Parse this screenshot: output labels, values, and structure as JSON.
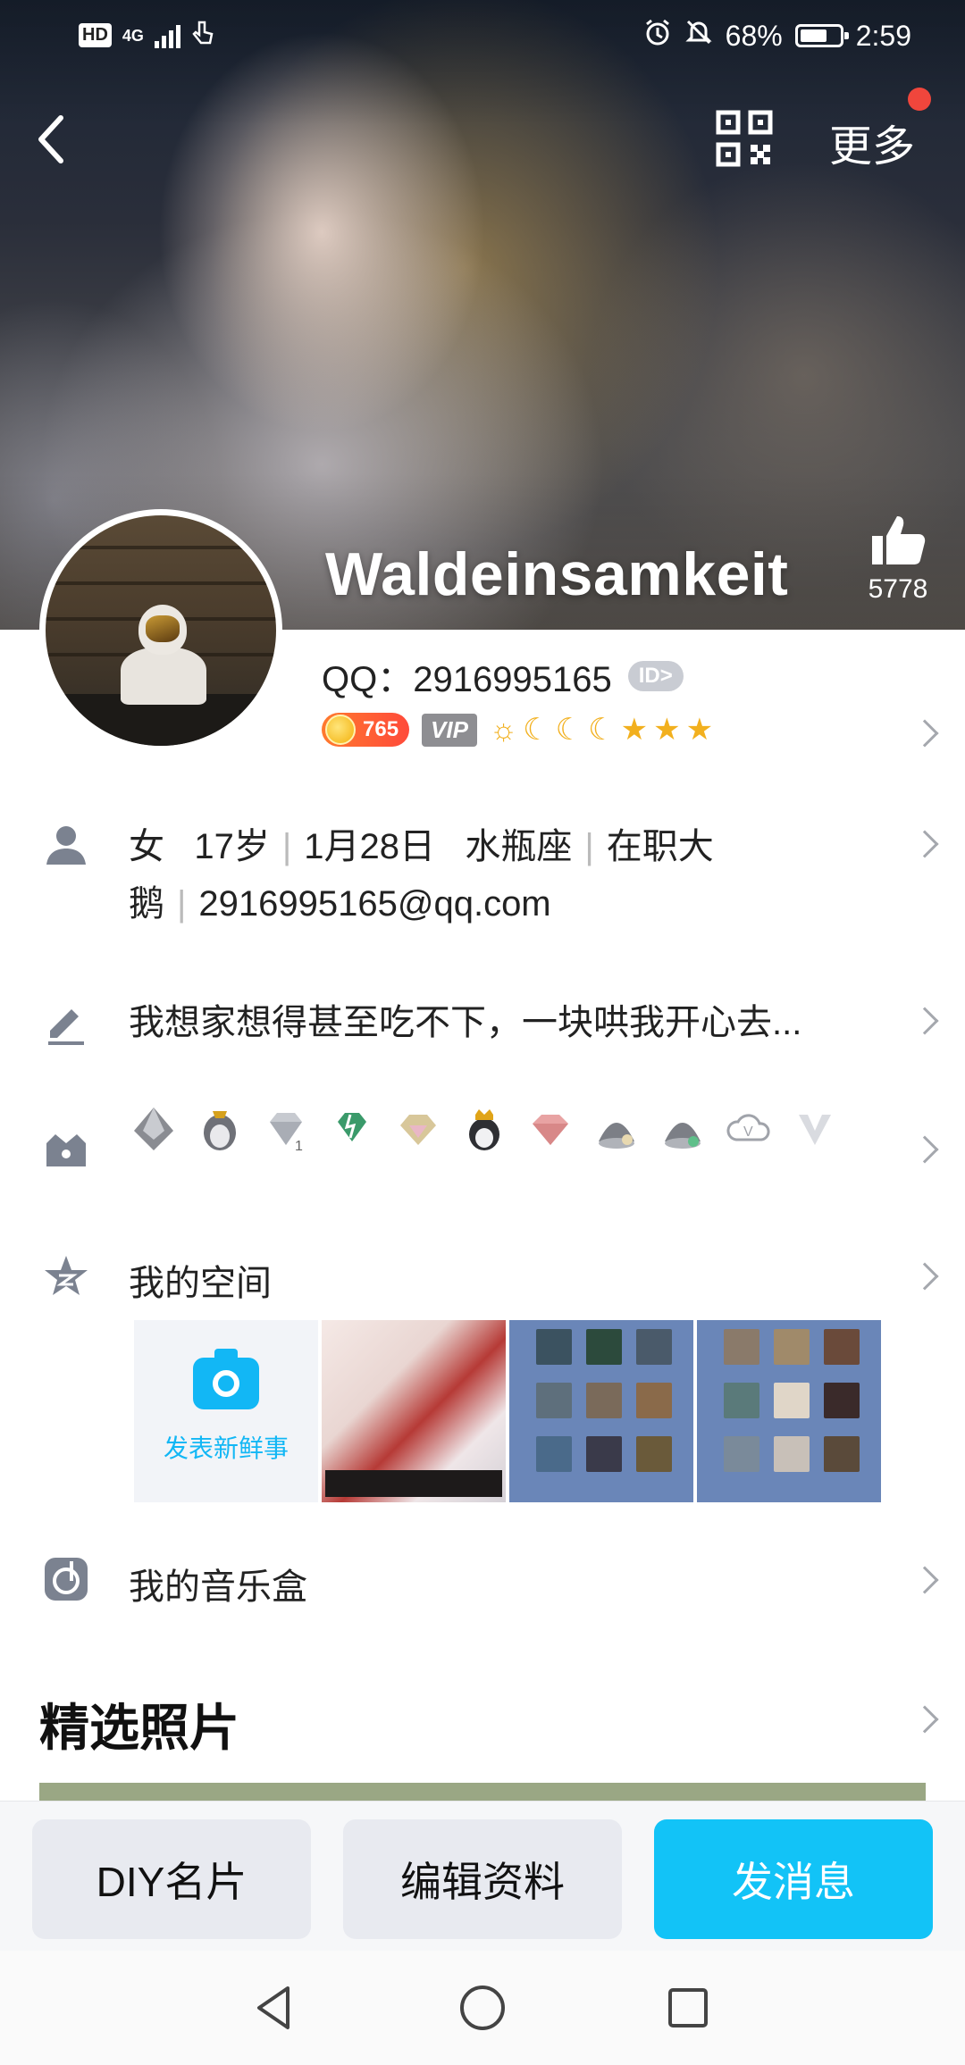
{
  "status_bar": {
    "hd": "HD",
    "network": "4G",
    "battery_percent": "68%",
    "time": "2:59"
  },
  "header": {
    "more_label": "更多",
    "nickname": "Waldeinsamkeit",
    "like_count": "5778"
  },
  "profile": {
    "qq_label": "QQ：2916995165",
    "id_badge": "ID>",
    "coin_value": "765",
    "vip_label": "VIP"
  },
  "info": {
    "gender": "女",
    "age": "17岁",
    "birthday": "1月28日",
    "zodiac": "水瓶座",
    "job": "在职大鹅",
    "email": "2916995165@qq.com",
    "signature": "我想家想得甚至吃不下，一块哄我开心去..."
  },
  "space": {
    "title": "我的空间",
    "post_label": "发表新鲜事"
  },
  "music": {
    "title": "我的音乐盒"
  },
  "photos": {
    "title": "精选照片"
  },
  "actions": {
    "diy": "DIY名片",
    "edit": "编辑资料",
    "message": "发消息"
  },
  "colors": {
    "accent": "#12c3f7",
    "red_dot": "#f0463c",
    "chevron": "#a5a8ae"
  }
}
